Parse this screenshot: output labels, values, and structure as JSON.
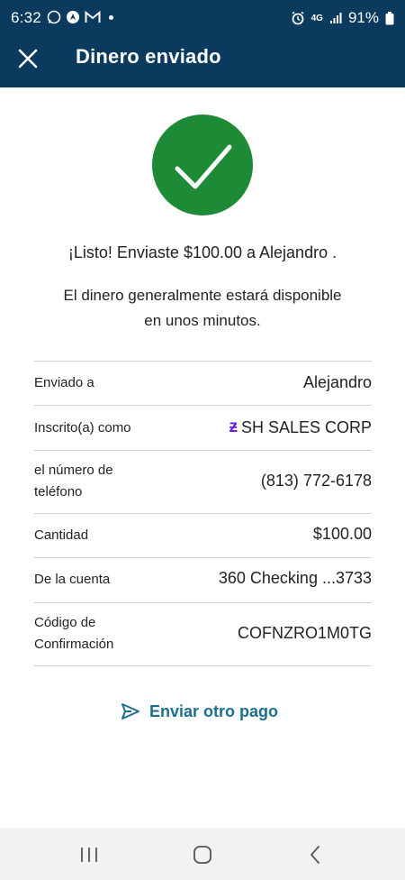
{
  "status_bar": {
    "time": "6:32",
    "battery": "91%",
    "network": "4G"
  },
  "header": {
    "title": "Dinero enviado",
    "background_color": "#0a3b5e"
  },
  "success": {
    "icon": "check-icon",
    "color": "#1d8a35",
    "message": "¡Listo! Enviaste $100.00 a Alejandro .",
    "note_line1": "El dinero generalmente estará disponible",
    "note_line2": "en unos minutos."
  },
  "details": [
    {
      "label": "Enviado a",
      "value": "Alejandro"
    },
    {
      "label": "Inscrito(a) como",
      "value": "SH SALES CORP",
      "icon": "zelle-icon"
    },
    {
      "label_line1": "el número de",
      "label_line2": "teléfono",
      "value": "(813) 772-6178"
    },
    {
      "label": "Cantidad",
      "value": "$100.00"
    },
    {
      "label": "De la cuenta",
      "value": "360 Checking ...3733"
    },
    {
      "label_line1": "Código de",
      "label_line2": "Confirmación",
      "value": "COFNZRO1M0TG"
    }
  ],
  "actions": {
    "send_another": "Enviar otro pago",
    "accent_color": "#1b6f91"
  }
}
